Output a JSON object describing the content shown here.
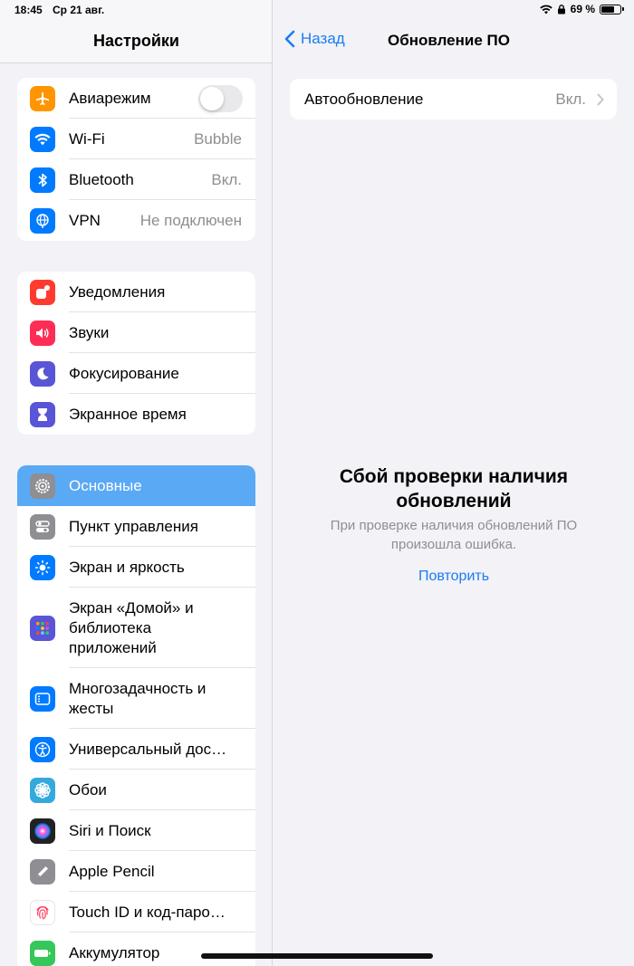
{
  "status": {
    "time": "18:45",
    "date": "Ср 21 авг.",
    "battery_percent": "69 %",
    "battery_level": 0.69
  },
  "sidebar": {
    "title": "Настройки",
    "groups": [
      {
        "items": [
          {
            "label": "Авиарежим",
            "icon": "airplane-icon",
            "color": "#ff9500",
            "toggle": false
          },
          {
            "label": "Wi-Fi",
            "value": "Bubble",
            "icon": "wifi-icon",
            "color": "#007aff"
          },
          {
            "label": "Bluetooth",
            "value": "Вкл.",
            "icon": "bluetooth-icon",
            "color": "#007aff"
          },
          {
            "label": "VPN",
            "value": "Не подключен",
            "icon": "vpn-globe-icon",
            "color": "#007aff"
          }
        ]
      },
      {
        "items": [
          {
            "label": "Уведомления",
            "icon": "notifications-icon",
            "color": "#ff3b30"
          },
          {
            "label": "Звуки",
            "icon": "speaker-icon",
            "color": "#ff2d55"
          },
          {
            "label": "Фокусирование",
            "icon": "moon-icon",
            "color": "#5856d6"
          },
          {
            "label": "Экранное время",
            "icon": "hourglass-icon",
            "color": "#5856d6"
          }
        ]
      },
      {
        "items": [
          {
            "label": "Основные",
            "icon": "gear-icon",
            "color": "#8e8e93",
            "selected": true
          },
          {
            "label": "Пункт управления",
            "icon": "switches-icon",
            "color": "#8e8e93"
          },
          {
            "label": "Экран и яркость",
            "icon": "sun-icon",
            "color": "#007aff"
          },
          {
            "label": "Экран «Домой» и библиотека приложений",
            "icon": "app-grid-icon",
            "color": "#5856d6"
          },
          {
            "label": "Многозадачность и жесты",
            "icon": "multitasking-icon",
            "color": "#007aff"
          },
          {
            "label": "Универсальный дос…",
            "icon": "accessibility-icon",
            "color": "#007aff"
          },
          {
            "label": "Обои",
            "icon": "flower-icon",
            "color": "#34aadc"
          },
          {
            "label": "Siri и Поиск",
            "icon": "siri-icon",
            "color": "#222222"
          },
          {
            "label": "Apple Pencil",
            "icon": "pencil-icon",
            "color": "#8e8e93"
          },
          {
            "label": "Touch ID и код-паро…",
            "icon": "fingerprint-icon",
            "color": "#ffffff"
          },
          {
            "label": "Аккумулятор",
            "icon": "battery-icon",
            "color": "#34c759"
          }
        ]
      }
    ]
  },
  "detail": {
    "back_label": "Назад",
    "title": "Обновление ПО",
    "auto_update": {
      "label": "Автообновление",
      "value": "Вкл."
    },
    "error_title": "Сбой проверки наличия обновлений",
    "error_text": "При проверке наличия обновлений ПО произошла ошибка.",
    "retry_label": "Повторить"
  }
}
